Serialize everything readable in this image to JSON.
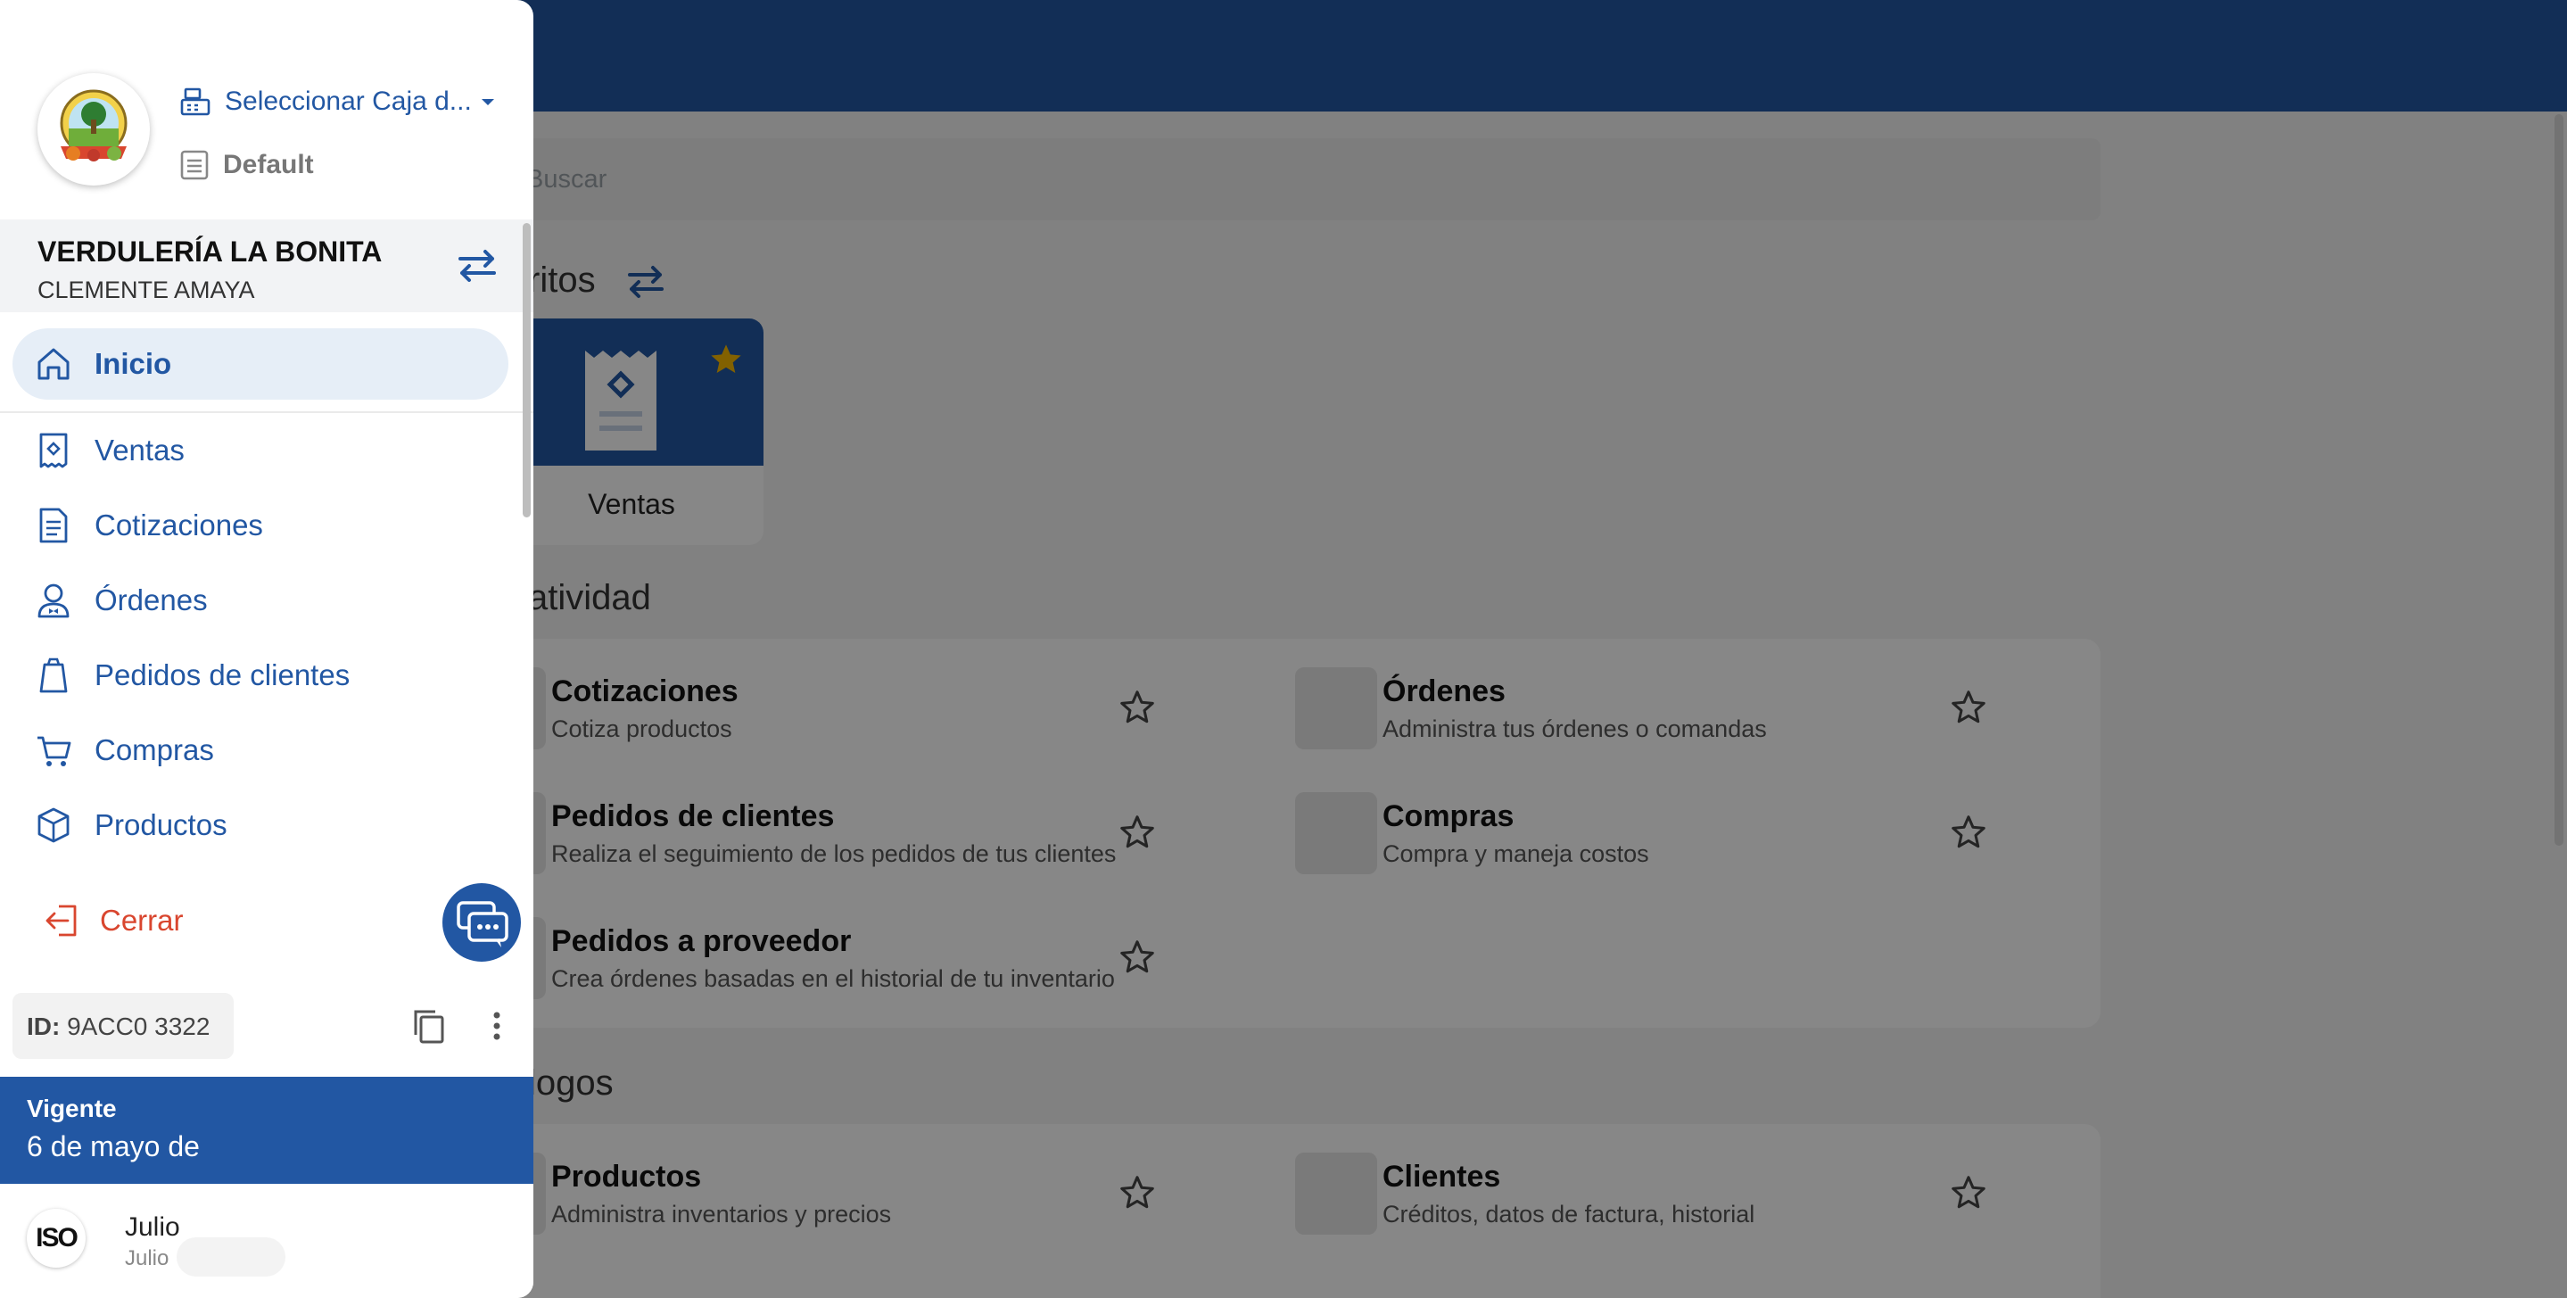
{
  "colors": {
    "primary": "#2257a3",
    "danger": "#d9462f",
    "favorite_star": "#f5b800"
  },
  "main": {
    "search_placeholder": "Buscar",
    "favorites_title": "ritos",
    "favorite_card": {
      "label": "Ventas",
      "icon": "receipt-icon",
      "starred": true
    },
    "productivity_title": "atividad",
    "productivity_items": [
      {
        "title": "Cotizaciones",
        "subtitle": "Cotiza productos"
      },
      {
        "title": "Órdenes",
        "subtitle": "Administra tus órdenes o comandas"
      },
      {
        "title": "Pedidos de clientes",
        "subtitle": "Realiza el seguimiento de los pedidos de tus clientes"
      },
      {
        "title": "Compras",
        "subtitle": "Compra y maneja costos"
      },
      {
        "title": "Pedidos a proveedor",
        "subtitle": "Crea órdenes basadas en el historial de tu inventario"
      }
    ],
    "catalogs_title": "logos",
    "catalog_items": [
      {
        "title": "Productos",
        "subtitle": "Administra inventarios y precios"
      },
      {
        "title": "Clientes",
        "subtitle": "Créditos, datos de factura, historial"
      }
    ]
  },
  "drawer": {
    "caja_label": "Seleccionar Caja d...",
    "warehouse_label": "Default",
    "business_name": "VERDULERÍA LA BONITA",
    "business_user": "CLEMENTE AMAYA",
    "nav": [
      {
        "label": "Inicio",
        "icon": "home-icon",
        "active": true
      },
      {
        "label": "Ventas",
        "icon": "receipt-icon"
      },
      {
        "label": "Cotizaciones",
        "icon": "document-icon"
      },
      {
        "label": "Órdenes",
        "icon": "waiter-icon"
      },
      {
        "label": "Pedidos de clientes",
        "icon": "bag-icon"
      },
      {
        "label": "Compras",
        "icon": "cart-icon"
      },
      {
        "label": "Productos",
        "icon": "box-icon"
      }
    ],
    "logout_label": "Cerrar",
    "id_prefix": "ID:",
    "id_value": "9ACC0 3322",
    "subscription_status": "Vigente",
    "subscription_date": "6 de mayo de",
    "user_name": "Julio",
    "user_sub": "Julio",
    "avatar_text": "ISO"
  }
}
